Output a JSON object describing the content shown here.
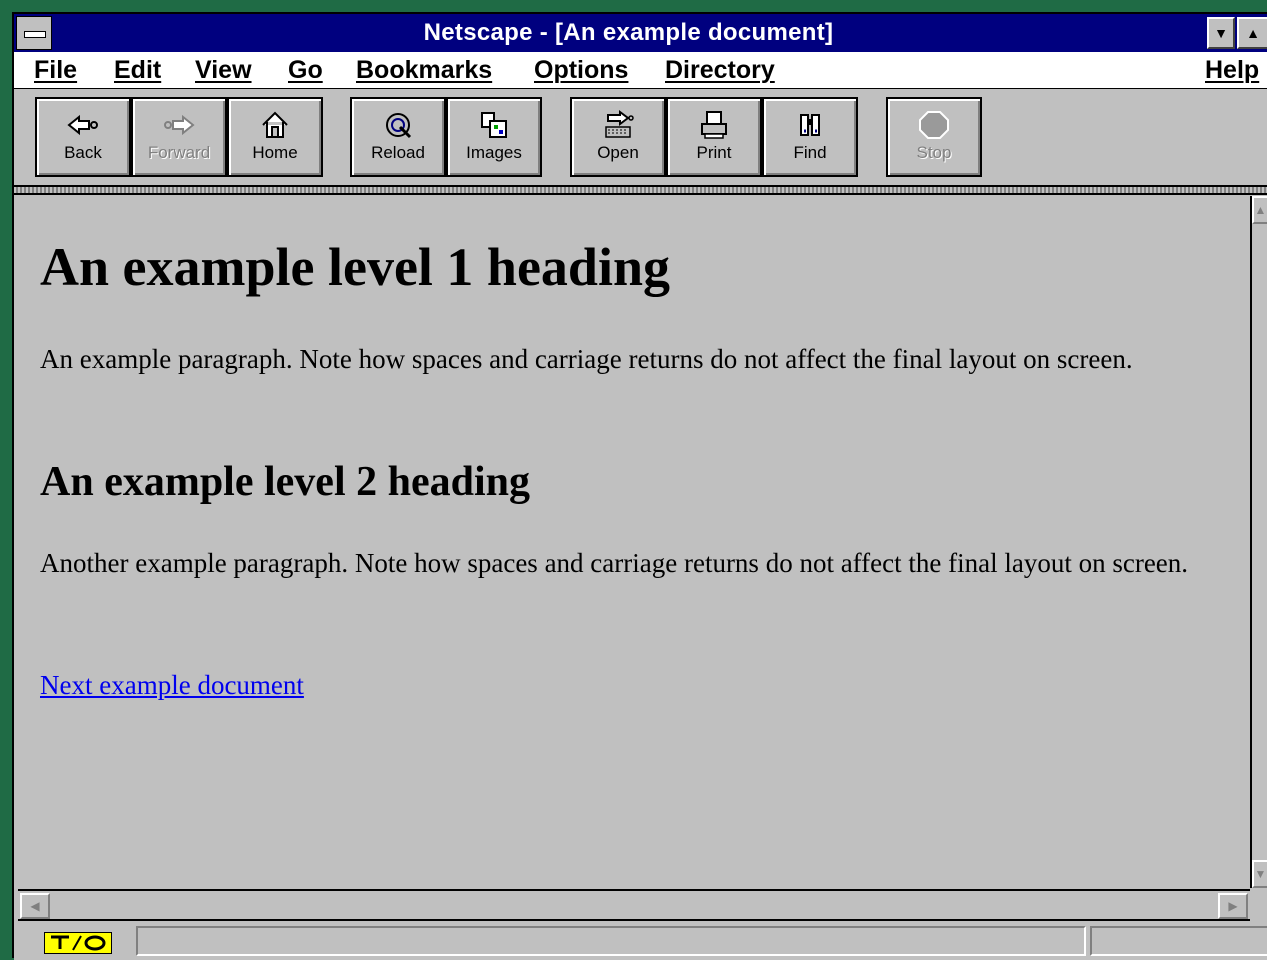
{
  "window": {
    "title": "Netscape - [An example document]"
  },
  "menu": {
    "items": [
      "File",
      "Edit",
      "View",
      "Go",
      "Bookmarks",
      "Options",
      "Directory"
    ],
    "help": "Help"
  },
  "toolbar": {
    "buttons": [
      {
        "label": "Back",
        "icon": "back-arrow-icon",
        "enabled": true
      },
      {
        "label": "Forward",
        "icon": "forward-arrow-icon",
        "enabled": false
      },
      {
        "label": "Home",
        "icon": "home-icon",
        "enabled": true
      },
      {
        "label": "Reload",
        "icon": "reload-icon",
        "enabled": true
      },
      {
        "label": "Images",
        "icon": "images-icon",
        "enabled": true
      },
      {
        "label": "Open",
        "icon": "open-icon",
        "enabled": true
      },
      {
        "label": "Print",
        "icon": "print-icon",
        "enabled": true
      },
      {
        "label": "Find",
        "icon": "find-icon",
        "enabled": true
      },
      {
        "label": "Stop",
        "icon": "stop-icon",
        "enabled": false
      }
    ]
  },
  "document": {
    "h1": "An example level 1 heading",
    "p1": "An example paragraph. Note how spaces and carriage returns do not affect the final layout on screen.",
    "h2": "An example level 2 heading",
    "p2": "Another example paragraph. Note how spaces and carriage returns do not affect the final layout on screen.",
    "link": "Next example document"
  },
  "colors": {
    "titlebar": "#00007f",
    "chrome": "#c0c0c0",
    "desktop": "#1f6b45",
    "link": "#0000ee"
  }
}
